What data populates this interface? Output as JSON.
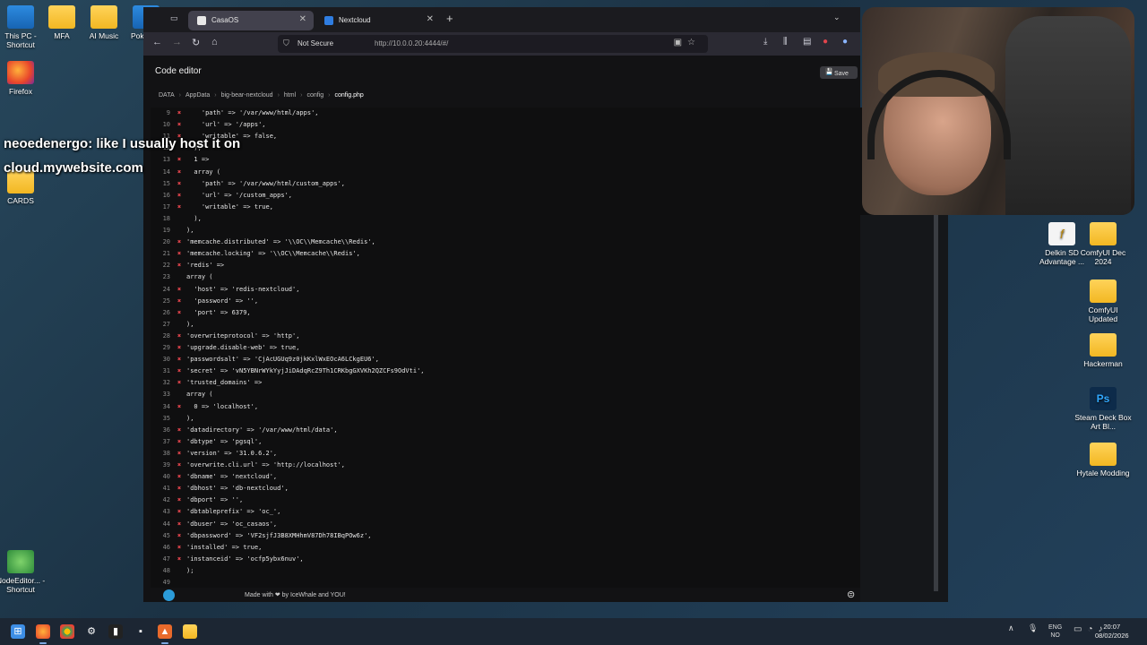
{
  "desktop": {
    "left_icons": [
      {
        "label": "This PC - Shortcut",
        "icon": "computer-icon"
      },
      {
        "label": "MFA",
        "icon": "folder-icon"
      },
      {
        "label": "AI Music",
        "icon": "folder-icon"
      },
      {
        "label": "Pok Auto",
        "icon": "app-icon"
      },
      {
        "label": "Firefox",
        "icon": "firefox-icon"
      },
      {
        "label": "CARDS",
        "icon": "folder-icon"
      },
      {
        "label": "NodeEditor... - Shortcut",
        "icon": "node-icon"
      }
    ],
    "right_icons": [
      {
        "label": "Delkin SD Advantage ...",
        "icon": "delkin-icon",
        "glyph": "f"
      },
      {
        "label": "ComfyUI Dec 2024",
        "icon": "folder-icon"
      },
      {
        "label": "ComfyUI Updated",
        "icon": "folder-icon"
      },
      {
        "label": "Hackerman",
        "icon": "folder-icon"
      },
      {
        "label": "Steam Deck Box Art Bl...",
        "icon": "photoshop-icon",
        "glyph": "Ps"
      },
      {
        "label": "Hytale Modding",
        "icon": "folder-icon"
      }
    ]
  },
  "browser": {
    "tabs": [
      {
        "label": "CasaOS",
        "active": true,
        "color": "#e8e8e8"
      },
      {
        "label": "Nextcloud",
        "active": false,
        "color": "#2f7de1"
      }
    ],
    "url": "http://10.0.0.20:4444/#/",
    "security": "Not Secure"
  },
  "editor": {
    "title": "Code editor",
    "save_label": "Save",
    "breadcrumb": [
      "DATA",
      "AppData",
      "big-bear-nextcloud",
      "html",
      "config",
      "config.php"
    ],
    "lines": [
      {
        "n": "9",
        "err": true,
        "text": "    'path' => '/var/www/html/apps',"
      },
      {
        "n": "10",
        "err": true,
        "text": "    'url' => '/apps',"
      },
      {
        "n": "11",
        "err": true,
        "text": "    'writable' => false,"
      },
      {
        "n": "12",
        "err": false,
        "text": "  ),"
      },
      {
        "n": "13",
        "err": true,
        "text": "  1 =>"
      },
      {
        "n": "14",
        "err": true,
        "text": "  array ("
      },
      {
        "n": "15",
        "err": true,
        "text": "    'path' => '/var/www/html/custom_apps',"
      },
      {
        "n": "16",
        "err": true,
        "text": "    'url' => '/custom_apps',"
      },
      {
        "n": "17",
        "err": true,
        "text": "    'writable' => true,"
      },
      {
        "n": "18",
        "err": false,
        "text": "  ),"
      },
      {
        "n": "19",
        "err": false,
        "text": "),"
      },
      {
        "n": "20",
        "err": true,
        "text": "'memcache.distributed' => '\\\\OC\\\\Memcache\\\\Redis',"
      },
      {
        "n": "21",
        "err": true,
        "text": "'memcache.locking' => '\\\\OC\\\\Memcache\\\\Redis',"
      },
      {
        "n": "22",
        "err": true,
        "text": "'redis' =>"
      },
      {
        "n": "23",
        "err": false,
        "text": "array ("
      },
      {
        "n": "24",
        "err": true,
        "text": "  'host' => 'redis-nextcloud',"
      },
      {
        "n": "25",
        "err": true,
        "text": "  'password' => '',"
      },
      {
        "n": "26",
        "err": true,
        "text": "  'port' => 6379,"
      },
      {
        "n": "27",
        "err": false,
        "text": "),"
      },
      {
        "n": "28",
        "err": true,
        "text": "'overwriteprotocol' => 'http',"
      },
      {
        "n": "29",
        "err": true,
        "text": "'upgrade.disable-web' => true,"
      },
      {
        "n": "30",
        "err": true,
        "text": "'passwordsalt' => 'CjAcUGUq9z0jkKxlWxEOcA6LCkgEU6',"
      },
      {
        "n": "31",
        "err": true,
        "text": "'secret' => 'vN5YBNrWYkYyjJiDAdqRcZ9Th1CRKbgGXVKh2QZCFs9OdVti',"
      },
      {
        "n": "32",
        "err": true,
        "text": "'trusted_domains' =>"
      },
      {
        "n": "33",
        "err": false,
        "text": "array ("
      },
      {
        "n": "34",
        "err": true,
        "text": "  0 => 'localhost',"
      },
      {
        "n": "35",
        "err": false,
        "text": "),"
      },
      {
        "n": "36",
        "err": true,
        "text": "'datadirectory' => '/var/www/html/data',"
      },
      {
        "n": "37",
        "err": true,
        "text": "'dbtype' => 'pgsql',"
      },
      {
        "n": "38",
        "err": true,
        "text": "'version' => '31.0.6.2',"
      },
      {
        "n": "39",
        "err": true,
        "text": "'overwrite.cli.url' => 'http://localhost',"
      },
      {
        "n": "40",
        "err": true,
        "text": "'dbname' => 'nextcloud',"
      },
      {
        "n": "41",
        "err": true,
        "text": "'dbhost' => 'db-nextcloud',"
      },
      {
        "n": "42",
        "err": true,
        "text": "'dbport' => '',"
      },
      {
        "n": "43",
        "err": true,
        "text": "'dbtableprefix' => 'oc_',"
      },
      {
        "n": "44",
        "err": true,
        "text": "'dbuser' => 'oc_casaos',"
      },
      {
        "n": "45",
        "err": true,
        "text": "'dbpassword' => 'VF2sjfJ3B8XMHhmV87Dh78IBqPOw6z',"
      },
      {
        "n": "46",
        "err": true,
        "text": "'installed' => true,"
      },
      {
        "n": "47",
        "err": true,
        "text": "'instanceid' => 'ocfp5ybx6nuv',"
      },
      {
        "n": "48",
        "err": false,
        "text": ");"
      },
      {
        "n": "49",
        "err": false,
        "text": ""
      }
    ],
    "footer_text": "Made with ❤ by IceWhale and YOU!"
  },
  "chat": {
    "username": "neoedenergo",
    "message": ": like I usually host it on cloud.mywebsite.com"
  },
  "taskbar": {
    "language": "ENG\nNO",
    "time": "20:07",
    "date": "08/02/2026"
  }
}
